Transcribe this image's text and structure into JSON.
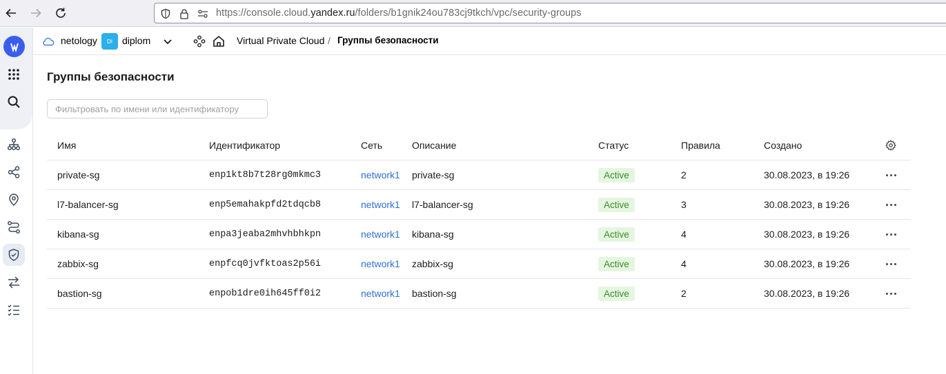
{
  "browser": {
    "url_prefix": "https://console.cloud.",
    "url_host": "yandex.ru",
    "url_path": "/folders/b1gnik24ou783cj9tkch/vpc/security-groups"
  },
  "header": {
    "cloud": "netology",
    "folder_badge": "DI",
    "folder": "diplom",
    "service": "Virtual Private Cloud",
    "separator": "/",
    "current": "Группы безопасности"
  },
  "page": {
    "title": "Группы безопасности",
    "filter_placeholder": "Фильтровать по имени или идентификатору"
  },
  "table": {
    "columns": {
      "name": "Имя",
      "id": "Идентификатор",
      "network": "Сеть",
      "description": "Описание",
      "status": "Статус",
      "rules": "Правила",
      "created": "Создано"
    },
    "rows": [
      {
        "name": "private-sg",
        "id": "enp1kt8b7t28rg0mkmc3",
        "network": "network1",
        "description": "private-sg",
        "status": "Active",
        "rules": "2",
        "created": "30.08.2023, в 19:26"
      },
      {
        "name": "l7-balancer-sg",
        "id": "enp5emahakpfd2tdqcb8",
        "network": "network1",
        "description": "l7-balancer-sg",
        "status": "Active",
        "rules": "3",
        "created": "30.08.2023, в 19:26"
      },
      {
        "name": "kibana-sg",
        "id": "enpa3jeaba2mhvhbhkpn",
        "network": "network1",
        "description": "kibana-sg",
        "status": "Active",
        "rules": "4",
        "created": "30.08.2023, в 19:26"
      },
      {
        "name": "zabbix-sg",
        "id": "enpfcq0jvfktoas2p56i",
        "network": "network1",
        "description": "zabbix-sg",
        "status": "Active",
        "rules": "4",
        "created": "30.08.2023, в 19:26"
      },
      {
        "name": "bastion-sg",
        "id": "enpob1dre0ih645ff0i2",
        "network": "network1",
        "description": "bastion-sg",
        "status": "Active",
        "rules": "2",
        "created": "30.08.2023, в 19:26"
      }
    ]
  },
  "icons": {
    "rail": [
      "services-grid-icon",
      "search-icon",
      "network-icon",
      "share-icon",
      "location-icon",
      "route-icon",
      "shield-icon",
      "transfer-icon",
      "checklist-icon"
    ]
  },
  "colors": {
    "brand": "#3a5df0",
    "link": "#2d6fd6",
    "status_bg": "#e5f6e0",
    "status_text": "#3b8b27"
  }
}
